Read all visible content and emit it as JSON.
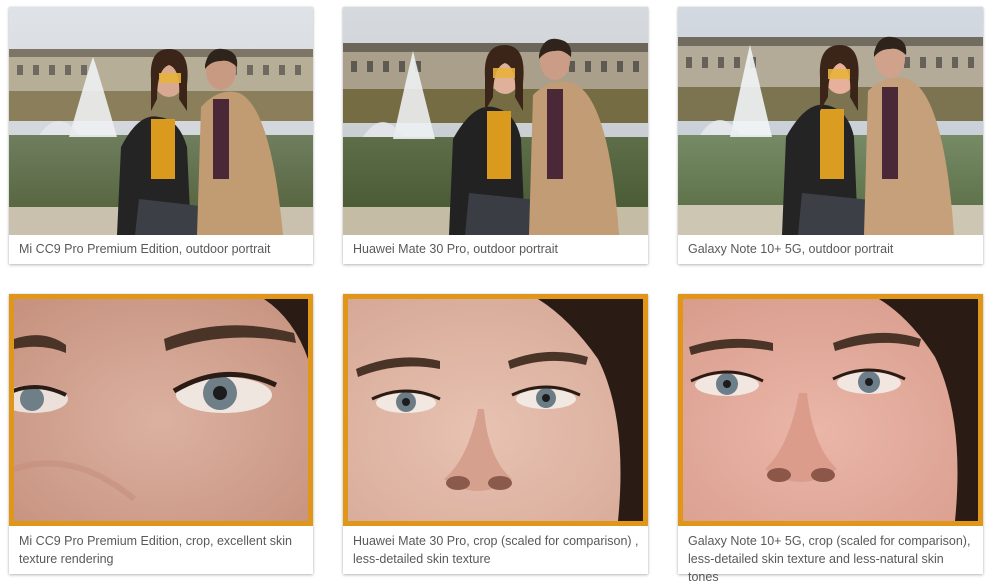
{
  "gallery": {
    "accent_color": "#e09618",
    "row1": [
      {
        "caption": "Mi CC9 Pro Premium Edition, outdoor portrait"
      },
      {
        "caption": "Huawei Mate 30 Pro, outdoor portrait"
      },
      {
        "caption": "Galaxy Note 10+ 5G, outdoor portrait"
      }
    ],
    "row2": [
      {
        "caption": "Mi CC9 Pro Premium Edition, crop, excellent skin texture rendering"
      },
      {
        "caption": "Huawei Mate 30 Pro, crop (scaled for comparison) , less-detailed skin texture"
      },
      {
        "caption": "Galaxy Note 10+ 5G, crop (scaled for comparison), less-detailed skin texture and less-natural skin tones"
      }
    ]
  }
}
